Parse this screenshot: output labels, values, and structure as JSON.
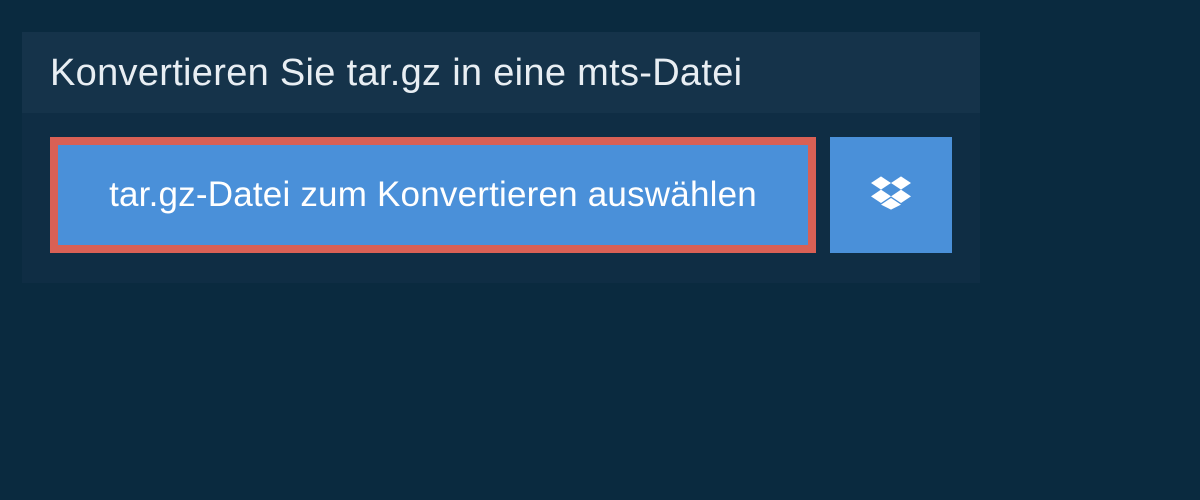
{
  "header": {
    "title": "Konvertieren Sie tar.gz in eine mts-Datei"
  },
  "buttons": {
    "select_file_label": "tar.gz-Datei zum Konvertieren auswählen"
  },
  "colors": {
    "background": "#0a2a3f",
    "panel": "#15334a",
    "panel_inner": "#0f2d44",
    "button": "#4a90d9",
    "highlight_border": "#d96055",
    "text_light": "#e8eef3",
    "text_white": "#ffffff"
  }
}
